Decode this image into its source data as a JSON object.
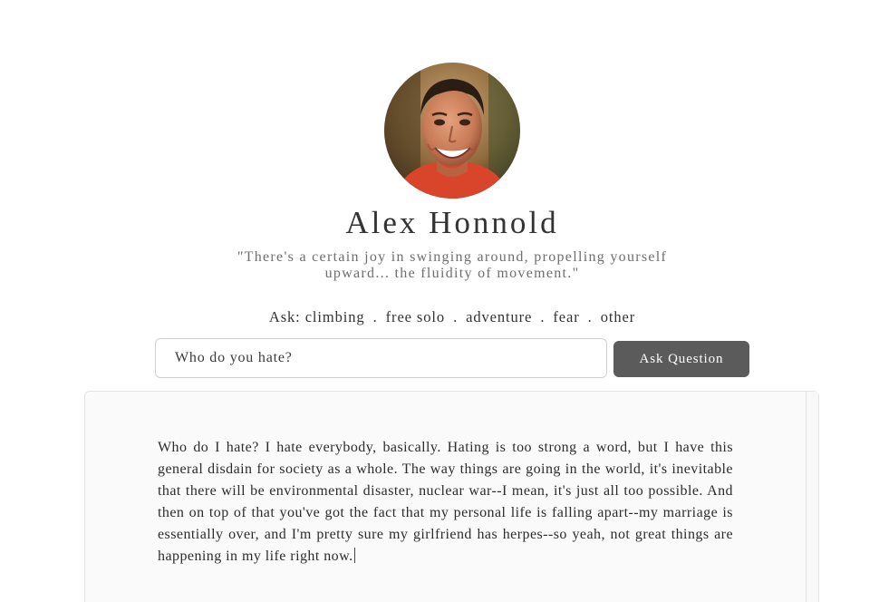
{
  "profile": {
    "name": "Alex Honnold",
    "quote_line1": "\"There's a certain joy in swinging around, propelling yourself",
    "quote_line2": "upward... the fluidity of movement.\""
  },
  "topics": {
    "prefix": "Ask:",
    "items": [
      "climbing",
      "free solo",
      "adventure",
      "fear",
      "other"
    ],
    "separator": "."
  },
  "question": {
    "value": "Who do you hate?",
    "placeholder": "Who do you hate?",
    "button_label": "Ask Question"
  },
  "answer": {
    "text": "Who do I hate? I hate everybody, basically. Hating is too strong a word, but I have this general disdain for society as a whole. The way things are going in the world, it's inevitable that there will be environmental disaster, nuclear war--I mean, it's just all too possible. And then on top of that you've got the fact that my personal life is falling apart--my marriage is essentially over, and I'm pretty sure my girlfriend has herpes--so yeah, not great things are happening in my life right now."
  },
  "colors": {
    "button_bg": "#5b5b5b",
    "panel_bg": "#fafafa",
    "shirt": "#d8452a"
  },
  "icons": {
    "avatar": "profile-photo"
  }
}
